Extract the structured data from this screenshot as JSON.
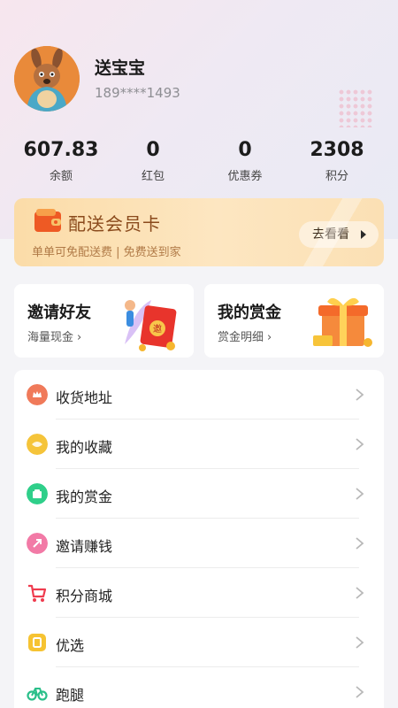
{
  "profile": {
    "name": "送宝宝",
    "phone": "189****1493"
  },
  "stats": [
    {
      "value": "607.83",
      "label": "余额"
    },
    {
      "value": "0",
      "label": "红包"
    },
    {
      "value": "0",
      "label": "优惠券"
    },
    {
      "value": "2308",
      "label": "积分"
    }
  ],
  "member_card": {
    "title": "配送会员卡",
    "subtitle": "单单可免配送费 | 免费送到家",
    "button_label": "去看看"
  },
  "promos": [
    {
      "title": "邀请好友",
      "subtitle": "海量现金",
      "art_label": "邀"
    },
    {
      "title": "我的赏金",
      "subtitle": "赏金明细"
    }
  ],
  "menu": [
    {
      "label": "收货地址",
      "icon": "address-icon",
      "color": "#f07a5a"
    },
    {
      "label": "我的收藏",
      "icon": "favorites-icon",
      "color": "#f5c43a"
    },
    {
      "label": "我的赏金",
      "icon": "bounty-icon",
      "color": "#2fcf8a"
    },
    {
      "label": "邀请赚钱",
      "icon": "invite-icon",
      "color": "#f27aa6"
    },
    {
      "label": "积分商城",
      "icon": "cart-icon",
      "color": "#ef3b4e"
    },
    {
      "label": "优选",
      "icon": "preferred-icon",
      "color": "#f6c332"
    },
    {
      "label": "跑腿",
      "icon": "bicycle-icon",
      "color": "#2bbf8a"
    }
  ]
}
